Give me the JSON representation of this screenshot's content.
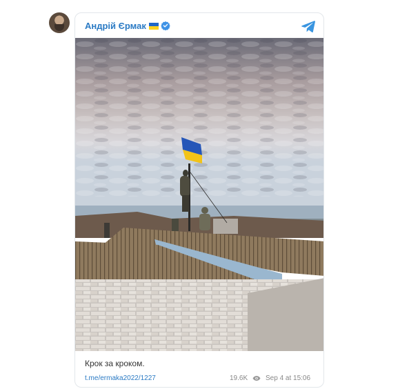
{
  "author": {
    "name": "Андрій Єрмак",
    "flag_icon": "ukraine-flag-icon",
    "verified_icon": "verified-badge-icon",
    "app_icon": "telegram-icon",
    "accent_color": "#2a7ac4"
  },
  "post": {
    "caption": "Крок за кроком.",
    "link": "t.me/ermaka2022/1227",
    "views": "19.6K",
    "date": "Sep 4 at 15:06",
    "image": "photo"
  }
}
